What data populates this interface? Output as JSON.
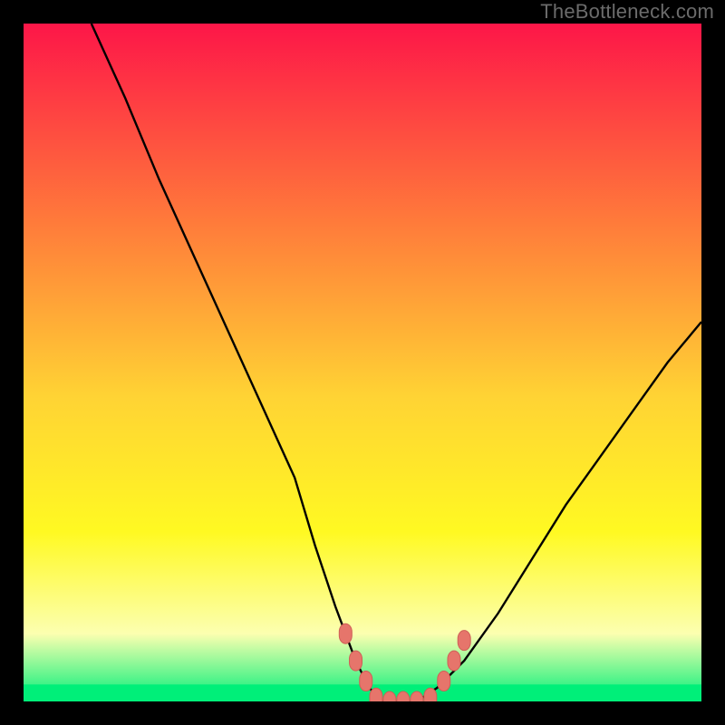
{
  "watermark": "TheBottleneck.com",
  "colors": {
    "frame": "#000000",
    "curve": "#000000",
    "marker_fill": "#e6756b",
    "marker_stroke": "#cf5f57",
    "green_band": "#00ef79",
    "gradient_top": "#fd1648",
    "gradient_mid1": "#ff7d3a",
    "gradient_mid2": "#ffd334",
    "gradient_mid3": "#fff922",
    "gradient_low": "#fcffb0",
    "gradient_bottom": "#00ef79"
  },
  "chart_data": {
    "type": "line",
    "title": "",
    "xlabel": "",
    "ylabel": "",
    "xlim": [
      0,
      100
    ],
    "ylim": [
      0,
      100
    ],
    "series": [
      {
        "name": "bottleneck-curve",
        "x": [
          10,
          15,
          20,
          25,
          30,
          35,
          40,
          43,
          46,
          49,
          51,
          53,
          56,
          58,
          61,
          65,
          70,
          75,
          80,
          85,
          90,
          95,
          100
        ],
        "y": [
          100,
          89,
          77,
          66,
          55,
          44,
          33,
          23,
          14,
          6,
          2,
          0,
          0,
          0,
          2,
          6,
          13,
          21,
          29,
          36,
          43,
          50,
          56
        ]
      }
    ],
    "markers": {
      "name": "highlight-points",
      "points": [
        {
          "x": 47.5,
          "y": 10
        },
        {
          "x": 49,
          "y": 6
        },
        {
          "x": 50.5,
          "y": 3
        },
        {
          "x": 52,
          "y": 0.5
        },
        {
          "x": 54,
          "y": 0
        },
        {
          "x": 56,
          "y": 0
        },
        {
          "x": 58,
          "y": 0
        },
        {
          "x": 60,
          "y": 0.5
        },
        {
          "x": 62,
          "y": 3
        },
        {
          "x": 63.5,
          "y": 6
        },
        {
          "x": 65,
          "y": 9
        }
      ]
    },
    "green_band": {
      "y0": 0,
      "y1": 2.5
    }
  }
}
